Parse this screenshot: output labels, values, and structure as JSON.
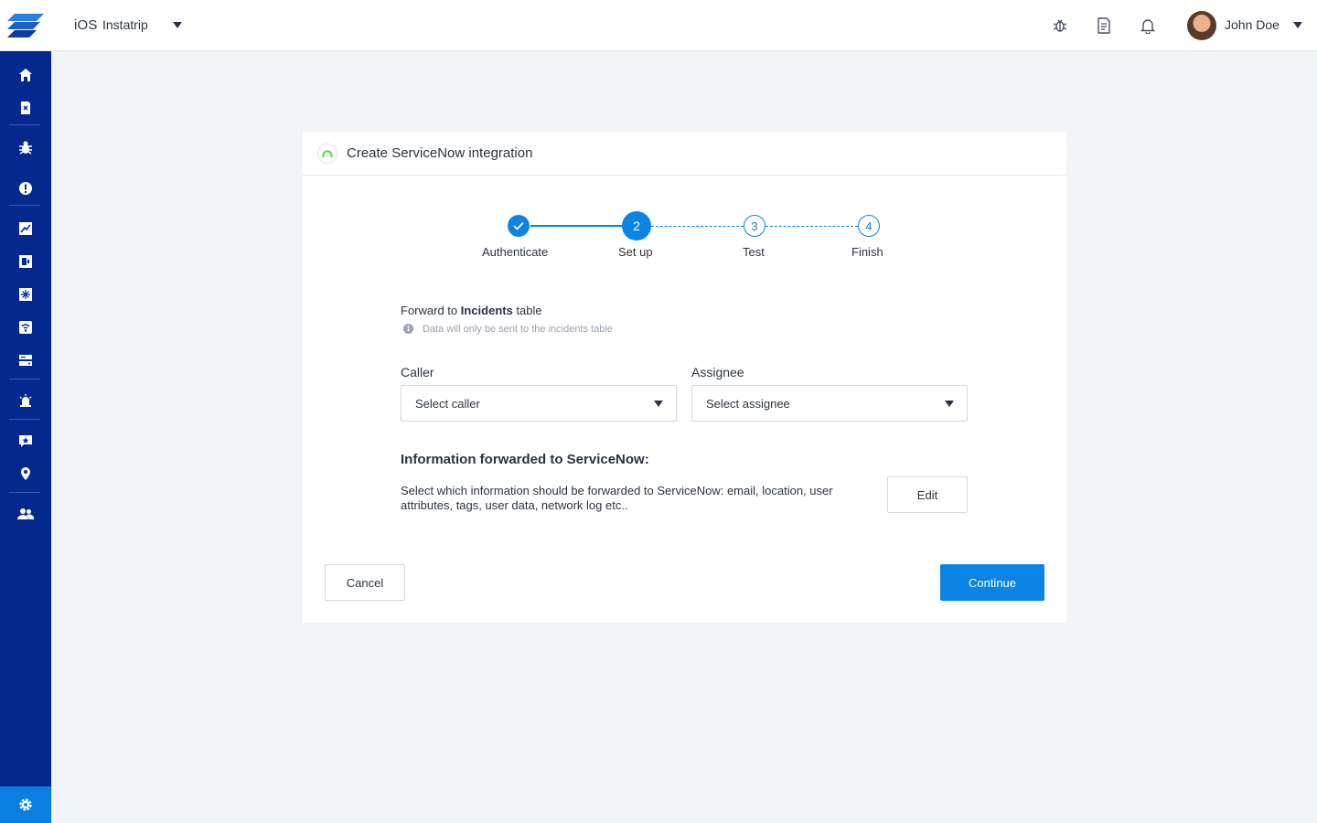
{
  "topbar": {
    "platform": "iOS",
    "app_name": "Instatrip",
    "user_name": "John Doe"
  },
  "sidebar": {
    "items": [
      {
        "icon": "home-icon"
      },
      {
        "icon": "crash-report-icon"
      },
      {
        "icon": "bug-icon"
      },
      {
        "icon": "alert-icon"
      },
      {
        "icon": "apm-icon"
      },
      {
        "icon": "sessions-icon"
      },
      {
        "icon": "features-icon"
      },
      {
        "icon": "network-icon"
      },
      {
        "icon": "storage-icon"
      },
      {
        "icon": "announcements-icon"
      },
      {
        "icon": "reviews-icon"
      },
      {
        "icon": "location-icon"
      },
      {
        "icon": "team-icon"
      }
    ],
    "settings_icon": "gear-icon"
  },
  "card": {
    "title": "Create ServiceNow integration",
    "steps": [
      {
        "label": "Authenticate",
        "state": "done",
        "number": ""
      },
      {
        "label": "Set up",
        "state": "current",
        "number": "2"
      },
      {
        "label": "Test",
        "state": "future",
        "number": "3"
      },
      {
        "label": "Finish",
        "state": "future",
        "number": "4"
      }
    ],
    "forward": {
      "prefix": "Forward to ",
      "table": "Incidents",
      "suffix": " table",
      "note": "Data will only be sent to the incidents table"
    },
    "caller": {
      "label": "Caller",
      "placeholder": "Select caller"
    },
    "assignee": {
      "label": "Assignee",
      "placeholder": "Select assignee"
    },
    "info": {
      "heading": "Information forwarded to ServiceNow:",
      "description": "Select which information should be forwarded to ServiceNow: email, location, user attributes, tags, user data, network log etc..",
      "edit_label": "Edit"
    },
    "cancel_label": "Cancel",
    "continue_label": "Continue"
  },
  "colors": {
    "sidebar": "#05288f",
    "accent": "#0a84e5",
    "background": "#f2f4f8"
  }
}
